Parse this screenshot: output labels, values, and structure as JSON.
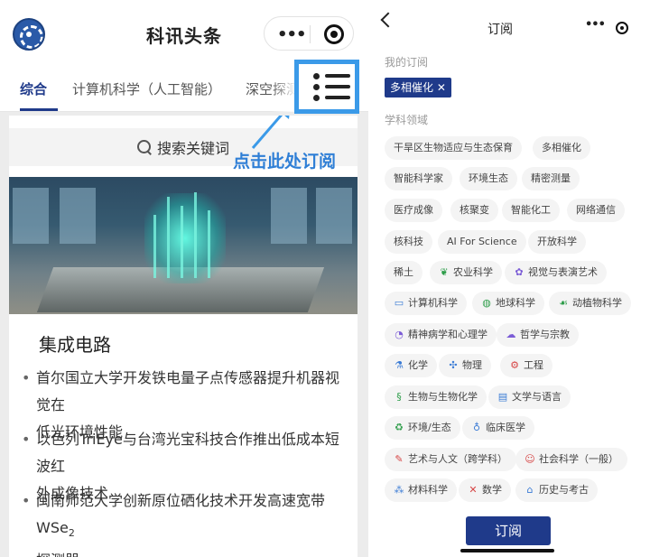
{
  "left": {
    "app_title": "科讯头条",
    "capsule": {
      "more_icon": "more-dots-icon",
      "close_icon": "target-icon"
    },
    "tabs": [
      {
        "label": "综合",
        "active": true
      },
      {
        "label": "计算机科学（人工智能）",
        "active": false
      },
      {
        "label": "深空探测",
        "active": false
      }
    ],
    "search_placeholder": "搜索关键词",
    "callout": "点击此处订阅",
    "category_title": "集成电路",
    "news": [
      {
        "lines": [
          "首尔国立大学开发铁电量子点传感器提升机器视觉在",
          "低光环境性能"
        ]
      },
      {
        "lines": [
          "以色列TriEye与台湾光宝科技合作推出低成本短波红",
          "外成像技术"
        ]
      },
      {
        "lines_prefix": "闽南师范大学创新原位硒化技术开发高速宽带WSe",
        "subscript": "2",
        "line2": "探测器"
      }
    ]
  },
  "right": {
    "title": "订阅",
    "my_subscriptions_label": "我的订阅",
    "my_tags": [
      {
        "label": "多相催化 ✕"
      }
    ],
    "fields_label": "学科领域",
    "chips": [
      {
        "label": "干旱区生物适应与生态保育",
        "icon": ""
      },
      {
        "label": "多相催化",
        "icon": ""
      },
      {
        "label": "智能科学家",
        "icon": ""
      },
      {
        "label": "环境生态",
        "icon": ""
      },
      {
        "label": "精密测量",
        "icon": ""
      },
      {
        "label": "医疗成像",
        "icon": ""
      },
      {
        "label": "核聚变",
        "icon": ""
      },
      {
        "label": "智能化工",
        "icon": ""
      },
      {
        "label": "网络通信",
        "icon": ""
      },
      {
        "label": "核科技",
        "icon": ""
      },
      {
        "label": "AI For Science",
        "icon": ""
      },
      {
        "label": "开放科学",
        "icon": ""
      },
      {
        "label": "稀土",
        "icon": ""
      },
      {
        "label": "农业科学",
        "icon": "leaf-icon"
      },
      {
        "label": "视觉与表演艺术",
        "icon": "palette-icon"
      },
      {
        "label": "计算机科学",
        "icon": "computer-icon"
      },
      {
        "label": "地球科学",
        "icon": "globe-icon"
      },
      {
        "label": "动植物科学",
        "icon": "animal-icon"
      },
      {
        "label": "精神病学和心理学",
        "icon": "brain-icon"
      },
      {
        "label": "哲学与宗教",
        "icon": "thought-icon"
      },
      {
        "label": "化学",
        "icon": "flask-icon"
      },
      {
        "label": "物理",
        "icon": "atom-icon"
      },
      {
        "label": "工程",
        "icon": "gear-icon"
      },
      {
        "label": "生物与生物化学",
        "icon": "dna-icon"
      },
      {
        "label": "文学与语言",
        "icon": "book-icon"
      },
      {
        "label": "环境/生态",
        "icon": "recycle-icon"
      },
      {
        "label": "临床医学",
        "icon": "stethoscope-icon"
      },
      {
        "label": "艺术与人文（跨学科）",
        "icon": "brush-icon"
      },
      {
        "label": "社会科学（一般）",
        "icon": "people-icon"
      },
      {
        "label": "材料科学",
        "icon": "molecule-icon"
      },
      {
        "label": "数学",
        "icon": "math-icon"
      },
      {
        "label": "历史与考古",
        "icon": "museum-icon"
      }
    ],
    "subscribe_button": "订阅",
    "colors": {
      "accent": "#1f3a8a",
      "callout": "#2f7fd6",
      "chip_bg": "#f4f4f4"
    }
  }
}
